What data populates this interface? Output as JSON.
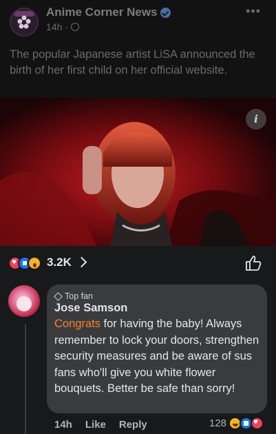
{
  "post": {
    "page_name": "Anime Corner News",
    "time": "14h ·",
    "text": "The popular Japanese artist LiSA announced the birth of her first child on her official website.",
    "reaction_count": "3.2K"
  },
  "comment": {
    "badge": "Top fan",
    "author": "Jose Samson",
    "highlight": "Congrats",
    "text": " for having the baby! Always remember to lock your doors, strengthen security measures and be aware of sus fans who'll give you white flower bouquets. Better be safe than sorry!",
    "time": "14h",
    "like_label": "Like",
    "reply_label": "Reply",
    "reaction_count": "128"
  },
  "icons": {
    "verified": "verified-icon",
    "globe": "globe-icon",
    "more": "more-icon",
    "info": "info-icon",
    "like": "thumbs-up-outline-icon",
    "top_fan": "diamond-icon"
  },
  "colors": {
    "background": "#18191a",
    "bubble": "#3a3b3c",
    "highlight": "#f58231",
    "text": "#e4e6eb",
    "muted": "#b0b3b8"
  }
}
